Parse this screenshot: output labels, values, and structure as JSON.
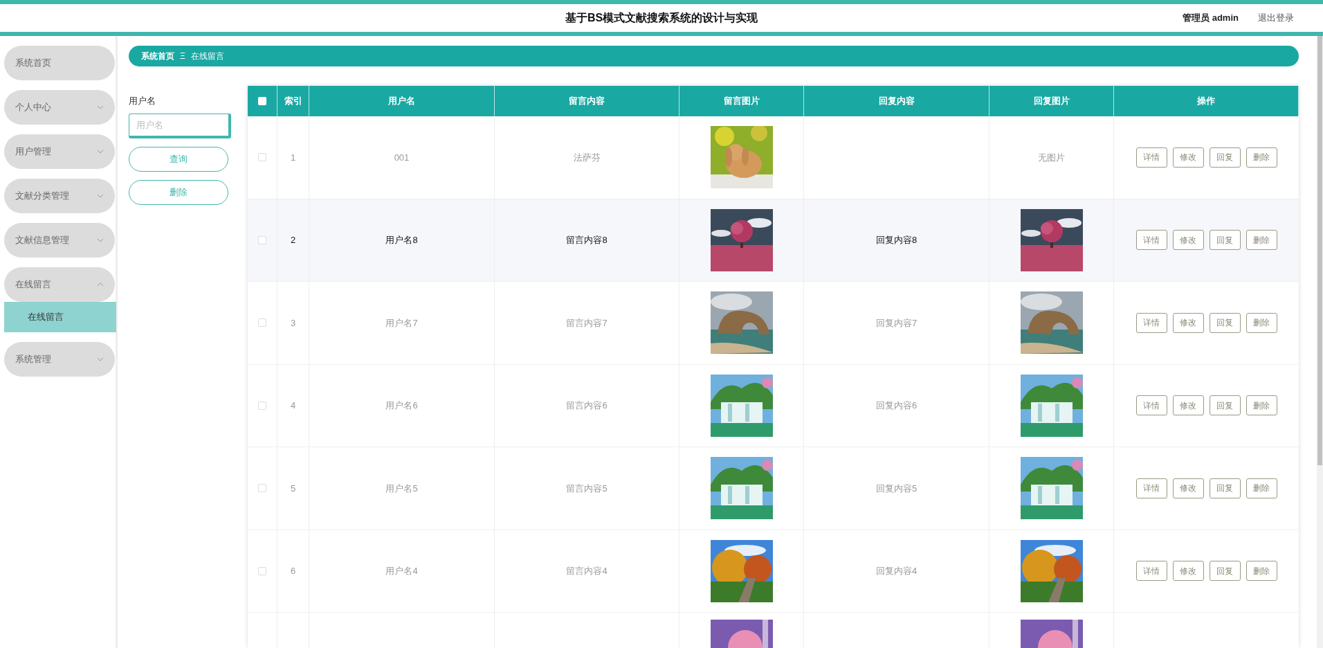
{
  "header": {
    "title": "基于BS模式文献搜索系统的设计与实现",
    "user_role": "管理员",
    "user_name": "admin",
    "logout": "退出登录"
  },
  "sidebar": {
    "items": [
      {
        "label": "系统首页"
      },
      {
        "label": "个人中心",
        "expanded": false
      },
      {
        "label": "用户管理",
        "expanded": false
      },
      {
        "label": "文献分类管理",
        "expanded": false
      },
      {
        "label": "文献信息管理",
        "expanded": false
      },
      {
        "label": "在线留言",
        "expanded": true,
        "children": [
          {
            "label": "在线留言",
            "selected": true
          }
        ]
      },
      {
        "label": "系统管理",
        "expanded": false
      }
    ]
  },
  "breadcrumb": {
    "home": "系统首页",
    "separator": "Ξ",
    "current": "在线留言"
  },
  "search": {
    "label": "用户名",
    "placeholder": "用户名",
    "buttons": [
      "查询",
      "删除"
    ]
  },
  "table": {
    "select_all": {
      "checked": false
    },
    "columns": [
      "索引",
      "用户名",
      "留言内容",
      "留言图片",
      "回复内容",
      "回复图片",
      "操作"
    ],
    "rows": [
      {
        "checked": false,
        "index": "1",
        "username": "001",
        "content": "法萨芬",
        "image": true,
        "reply_image": false,
        "no_image_text": "无图片",
        "highlighted": false,
        "actions": [
          "详情",
          "修改",
          "回复",
          "删除"
        ]
      },
      {
        "checked": false,
        "index": "2",
        "username": "用户名8",
        "content": "留言内容8",
        "image": true,
        "reply": "回复内容8",
        "reply_image": true,
        "highlighted": true,
        "actions": [
          "详情",
          "修改",
          "回复",
          "删除"
        ]
      },
      {
        "checked": false,
        "index": "3",
        "username": "用户名7",
        "content": "留言内容7",
        "image": true,
        "reply": "回复内容7",
        "reply_image": true,
        "highlighted": false,
        "actions": [
          "详情",
          "修改",
          "回复",
          "删除"
        ]
      },
      {
        "checked": false,
        "index": "4",
        "username": "用户名6",
        "content": "留言内容6",
        "image": true,
        "reply": "回复内容6",
        "reply_image": true,
        "highlighted": false,
        "actions": [
          "详情",
          "修改",
          "回复",
          "删除"
        ]
      },
      {
        "checked": false,
        "index": "5",
        "username": "用户名5",
        "content": "留言内容5",
        "image": true,
        "reply": "回复内容5",
        "reply_image": true,
        "highlighted": false,
        "actions": [
          "详情",
          "修改",
          "回复",
          "删除"
        ]
      },
      {
        "checked": false,
        "index": "6",
        "username": "用户名4",
        "content": "留言内容4",
        "image": true,
        "reply": "回复内容4",
        "reply_image": true,
        "highlighted": false,
        "actions": [
          "详情",
          "修改",
          "回复",
          "删除"
        ]
      },
      {
        "image": true,
        "reply_image": true
      }
    ]
  }
}
